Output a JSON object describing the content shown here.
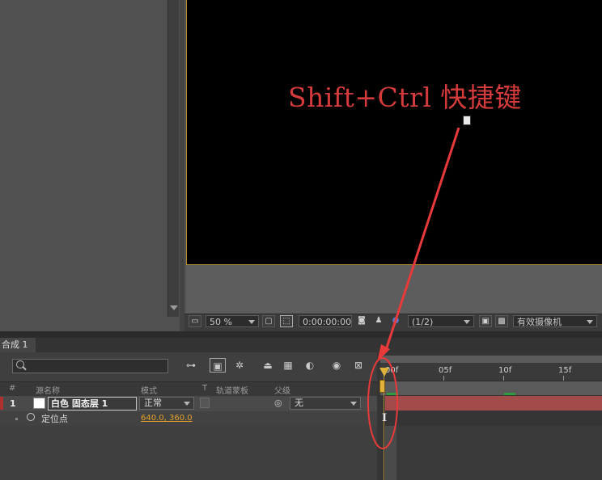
{
  "viewer": {
    "overlay_text": "Shift+Ctrl 快捷键",
    "zoom": "50 %",
    "timecode": "0:00:00:00",
    "resolution": "(1/2)",
    "camera": "有效摄像机"
  },
  "timeline": {
    "tab_label": "合成 1",
    "search_placeholder": "",
    "columns": {
      "num": "#",
      "source_name": "源名称",
      "mode": "模式",
      "t": "T",
      "trkmat": "轨道蒙板",
      "parent": "父级"
    },
    "layer": {
      "number": "1",
      "name": "白色 固态层 1",
      "mode": "正常",
      "parent": "无"
    },
    "property": {
      "name": "定位点",
      "value": "640.0, 360.0"
    },
    "ruler": {
      "labels": [
        "00f",
        "05f",
        "10f",
        "15f"
      ]
    },
    "keyframe_marker": "I"
  },
  "colors": {
    "accent": "#e0b23a",
    "annotation": "#e83a3a",
    "layer_bar": "#a34a4a"
  }
}
